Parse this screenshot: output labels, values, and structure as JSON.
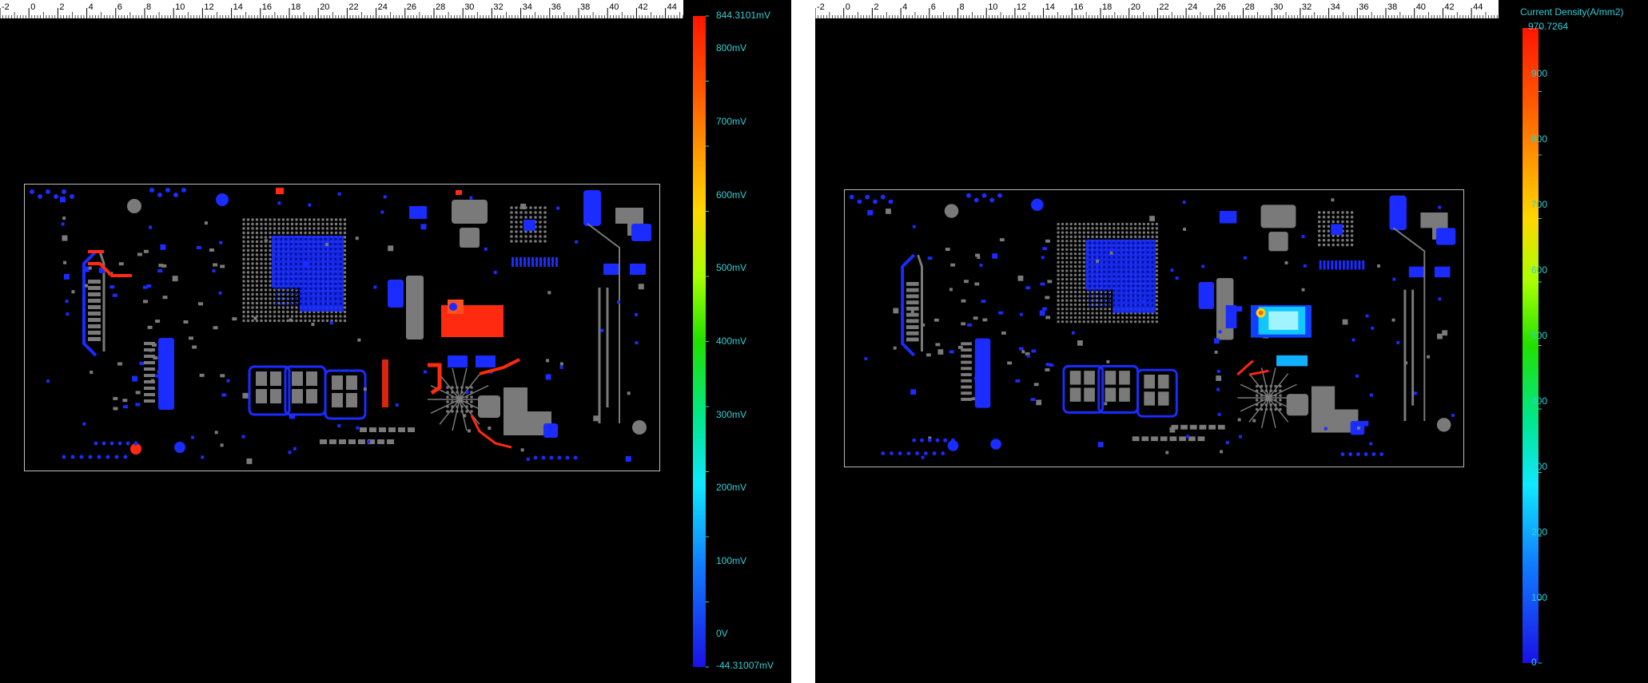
{
  "left_view": {
    "ruler_ticks": [
      "-2",
      "0",
      "2",
      "4",
      "6",
      "8",
      "10",
      "12",
      "14",
      "16",
      "18",
      "20",
      "22",
      "24",
      "26",
      "28",
      "30",
      "32",
      "34",
      "36",
      "38",
      "40",
      "42",
      "44"
    ],
    "colorbar": {
      "title": "",
      "max_label": "844.3101mV",
      "min_label": "-44.31007mV",
      "tick_labels": [
        "800mV",
        "700mV",
        "600mV",
        "500mV",
        "400mV",
        "300mV",
        "200mV",
        "100mV",
        "0V"
      ],
      "min_value": -44.31007,
      "max_value": 844.3101,
      "tick_values": [
        800,
        700,
        600,
        500,
        400,
        300,
        200,
        100,
        0
      ]
    }
  },
  "right_view": {
    "ruler_ticks": [
      "-2",
      "0",
      "2",
      "4",
      "6",
      "8",
      "10",
      "12",
      "14",
      "16",
      "18",
      "20",
      "22",
      "24",
      "26",
      "28",
      "30",
      "32",
      "34",
      "36",
      "38",
      "40",
      "42",
      "44"
    ],
    "colorbar": {
      "title": "Current Density(A/mm2)",
      "max_label": "970.7264",
      "min_label": "",
      "tick_labels": [
        "900",
        "800",
        "700",
        "600",
        "500",
        "400",
        "300",
        "200",
        "100",
        "0"
      ],
      "min_value": 0,
      "max_value": 970.7264,
      "tick_values": [
        900,
        800,
        700,
        600,
        500,
        400,
        300,
        200,
        100,
        0
      ]
    }
  },
  "colors": {
    "background": "#000000",
    "pad_gray": "#7a7a7a",
    "plane_blue": "#1a2cff",
    "hot_red": "#ff2a10",
    "label_cyan": "#2fd0d8",
    "colormap": [
      "#ff1500",
      "#ff7a00",
      "#ffd000",
      "#a8ff00",
      "#18e000",
      "#00e89a",
      "#10e8ff",
      "#1080ff",
      "#1530ff",
      "#1a10e6"
    ]
  }
}
